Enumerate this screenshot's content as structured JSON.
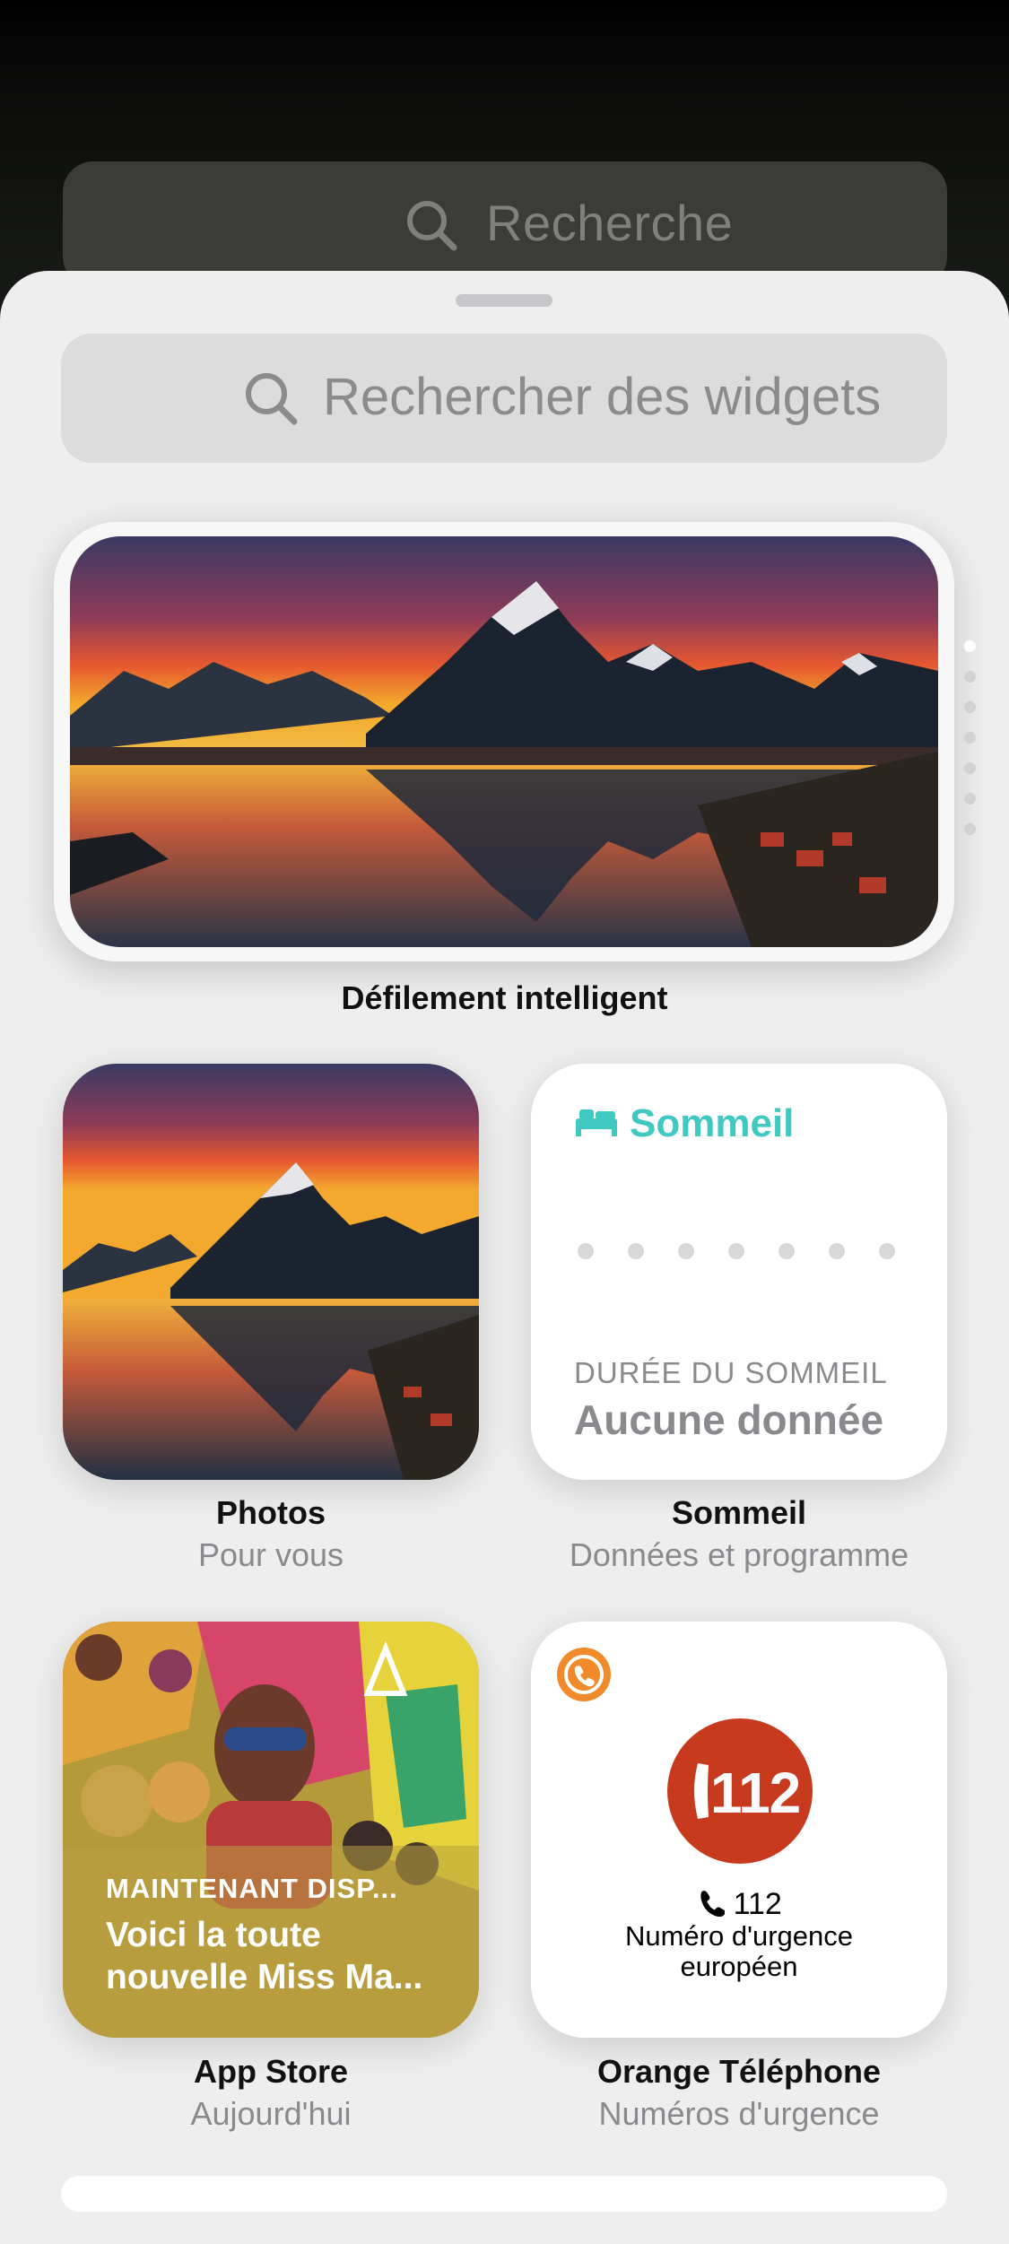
{
  "background": {
    "search_placeholder": "Recherche"
  },
  "widget_gallery": {
    "search_placeholder": "Rechercher des widgets",
    "page_indicator": {
      "pages": 7,
      "current": 1
    },
    "widgets": {
      "smart_stack": {
        "title": "Défilement intelligent"
      },
      "photos": {
        "title": "Photos",
        "subtitle": "Pour vous"
      },
      "sleep": {
        "title": "Sommeil",
        "subtitle": "Données et programme",
        "header": "Sommeil",
        "metric_label": "DURÉE DU SOMMEIL",
        "metric_value": "Aucune donnée",
        "dots": 7,
        "accent": "#3fc9c1"
      },
      "app_store": {
        "title": "App Store",
        "subtitle": "Aujourd'hui",
        "kicker": "MAINTENANT DISP...",
        "headline": "Voici la toute nouvelle Miss Ma..."
      },
      "orange_phone": {
        "title": "Orange Téléphone",
        "subtitle": "Numéros d'urgence",
        "badge_number": "112",
        "number": "112",
        "description": "Numéro d'urgence européen",
        "accent": "#c83a1e"
      }
    }
  }
}
